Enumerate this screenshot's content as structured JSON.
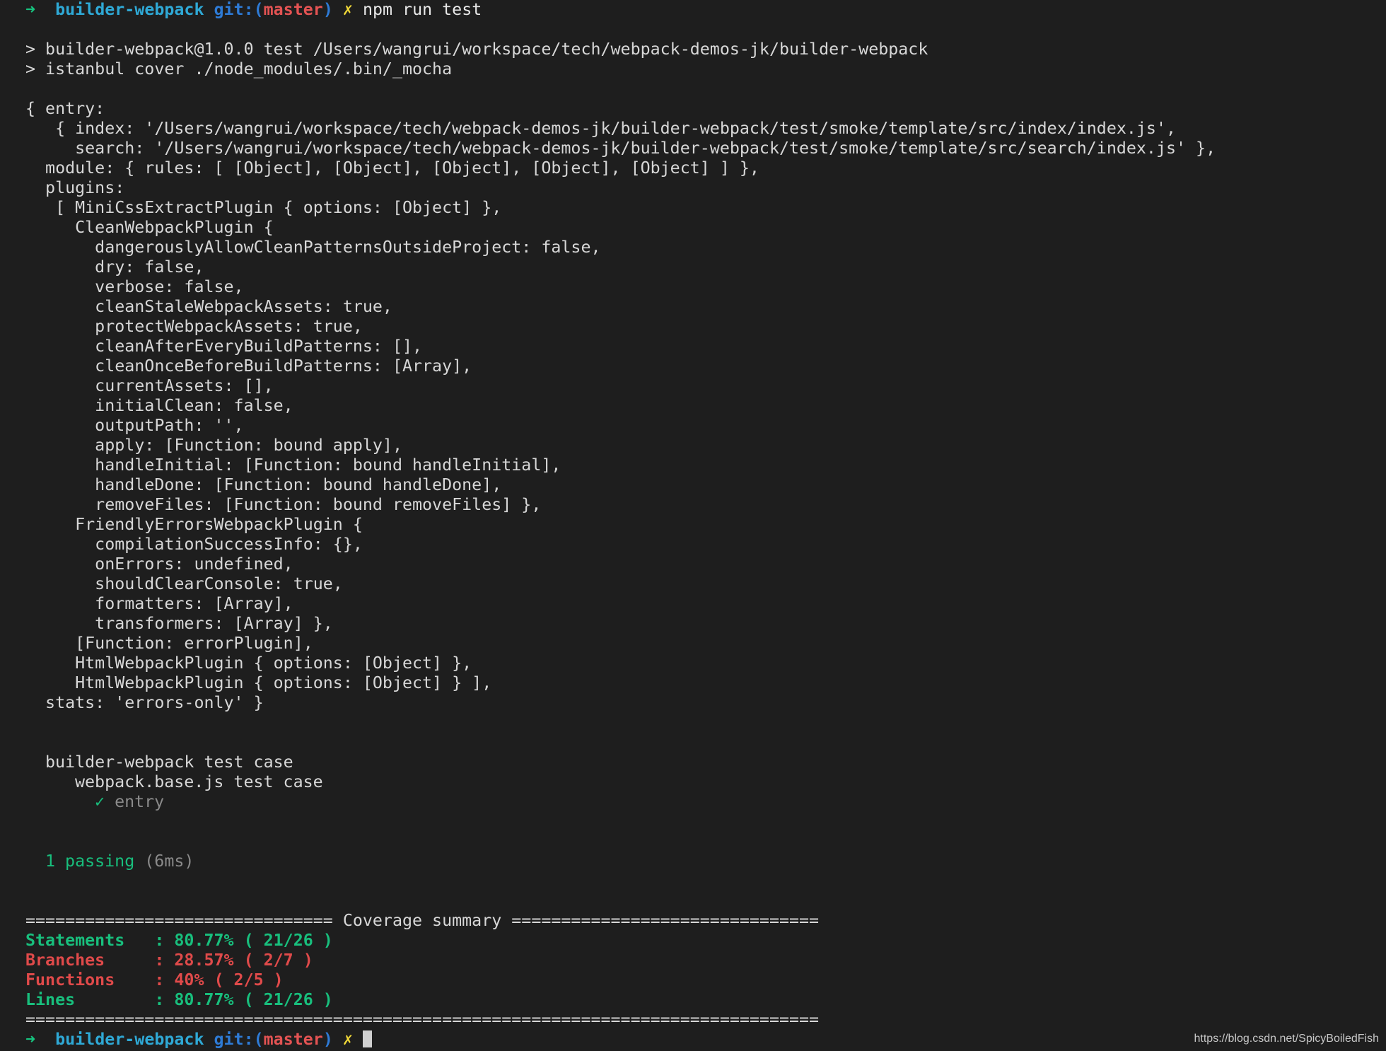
{
  "prompt": {
    "arrow": "➜",
    "dir": "builder-webpack",
    "git_label": "git:(",
    "branch": "master",
    "git_close": ")",
    "dirty_mark": "✗",
    "command": "npm run test"
  },
  "npm_header": [
    "> builder-webpack@1.0.0 test /Users/wangrui/workspace/tech/webpack-demos-jk/builder-webpack",
    "> istanbul cover ./node_modules/.bin/_mocha"
  ],
  "config_dump": [
    "{ entry:",
    "   { index: '/Users/wangrui/workspace/tech/webpack-demos-jk/builder-webpack/test/smoke/template/src/index/index.js',",
    "     search: '/Users/wangrui/workspace/tech/webpack-demos-jk/builder-webpack/test/smoke/template/src/search/index.js' },",
    "  module: { rules: [ [Object], [Object], [Object], [Object], [Object] ] },",
    "  plugins:",
    "   [ MiniCssExtractPlugin { options: [Object] },",
    "     CleanWebpackPlugin {",
    "       dangerouslyAllowCleanPatternsOutsideProject: false,",
    "       dry: false,",
    "       verbose: false,",
    "       cleanStaleWebpackAssets: true,",
    "       protectWebpackAssets: true,",
    "       cleanAfterEveryBuildPatterns: [],",
    "       cleanOnceBeforeBuildPatterns: [Array],",
    "       currentAssets: [],",
    "       initialClean: false,",
    "       outputPath: '',",
    "       apply: [Function: bound apply],",
    "       handleInitial: [Function: bound handleInitial],",
    "       handleDone: [Function: bound handleDone],",
    "       removeFiles: [Function: bound removeFiles] },",
    "     FriendlyErrorsWebpackPlugin {",
    "       compilationSuccessInfo: {},",
    "       onErrors: undefined,",
    "       shouldClearConsole: true,",
    "       formatters: [Array],",
    "       transformers: [Array] },",
    "     [Function: errorPlugin],",
    "     HtmlWebpackPlugin { options: [Object] },",
    "     HtmlWebpackPlugin { options: [Object] } ],",
    "  stats: 'errors-only' }"
  ],
  "tests": {
    "suite": "builder-webpack test case",
    "subsuite": "webpack.base.js test case",
    "check_mark": "✓",
    "case": "entry",
    "passing": "1 passing",
    "duration": "(6ms)"
  },
  "coverage": {
    "header": "=============================== Coverage summary ===============================",
    "footer": "================================================================================",
    "rows": [
      {
        "label": "Statements   : 80.77% ( 21/26 )",
        "color": "#18bf7d"
      },
      {
        "label": "Branches     : 28.57% ( 2/7 )",
        "color": "#e04a4a"
      },
      {
        "label": "Functions    : 40% ( 2/5 )",
        "color": "#e04a4a"
      },
      {
        "label": "Lines        : 80.77% ( 21/26 )",
        "color": "#18bf7d"
      }
    ]
  },
  "watermark": "https://blog.csdn.net/SpicyBoiledFish"
}
